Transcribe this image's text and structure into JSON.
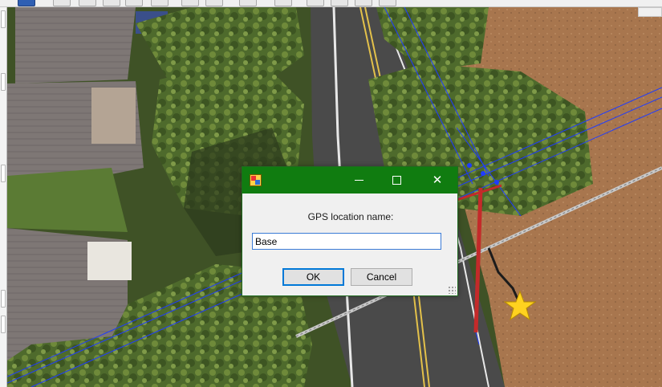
{
  "toolbar": {
    "buttons": [
      "layout-icon",
      "pan-icon",
      "select-icon",
      "layer-icon",
      "measure-icon",
      "globe-icon",
      "terrain-icon",
      "marker-icon",
      "person-icon",
      "view-1-icon",
      "view-2-icon",
      "view-3-icon",
      "view-4-icon"
    ]
  },
  "map": {
    "colors": {
      "field": "#a8764e",
      "road": "#4a4a4a",
      "roof": "#8a7a74",
      "trees": "#4e6a2c",
      "wire": "#1f3cff",
      "pole": "#c42a2a",
      "star": "#ffd21f"
    },
    "markers": [
      {
        "type": "star",
        "icon": "star-marker-icon"
      }
    ]
  },
  "dialog": {
    "icon": "app-icon",
    "prompt": "GPS location name:",
    "input_value": "Base",
    "ok_label": "OK",
    "cancel_label": "Cancel",
    "minimize_glyph": "—",
    "maximize_glyph": "☐",
    "close_glyph": "✕",
    "accent": "#107c10"
  }
}
